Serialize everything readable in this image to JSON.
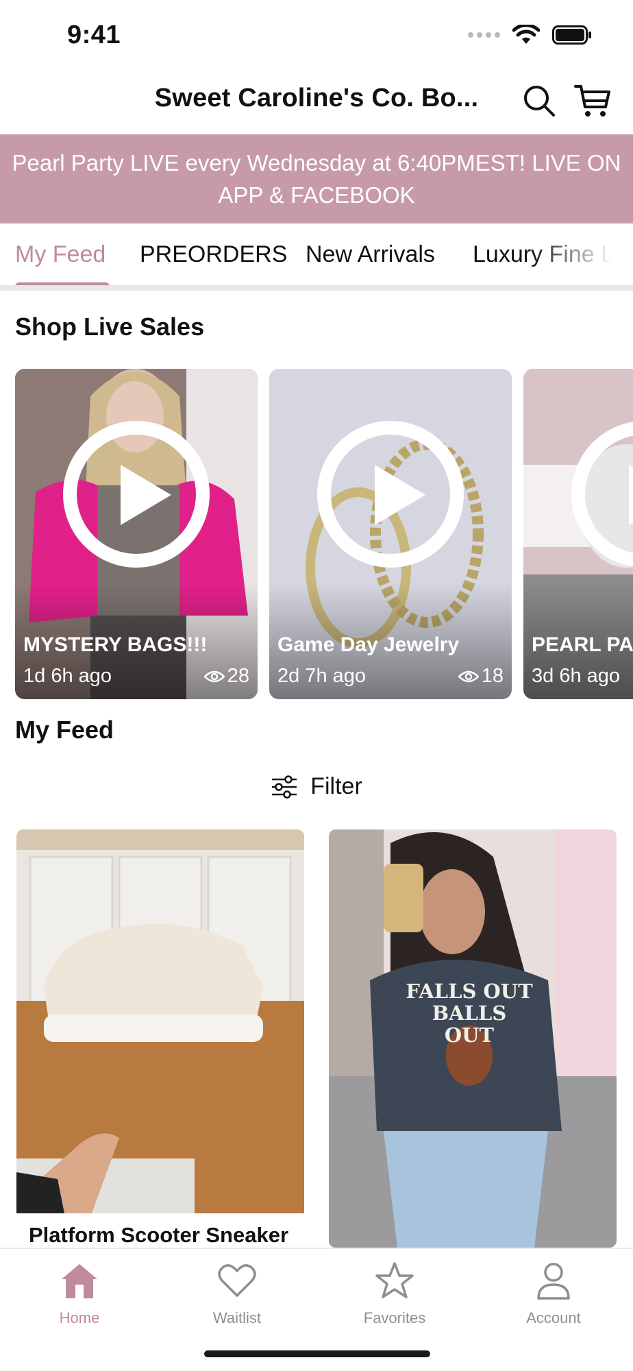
{
  "status_bar": {
    "time": "9:41"
  },
  "header": {
    "title": "Sweet Caroline's Co. Bo..."
  },
  "announcement": {
    "text": "Pearl Party LIVE every Wednesday at 6:40PMEST! LIVE ON APP & FACEBOOK"
  },
  "tabs": [
    {
      "label": "My Feed",
      "active": true
    },
    {
      "label": "PREORDERS"
    },
    {
      "label": "New Arrivals"
    },
    {
      "label": "Luxury Fine L"
    }
  ],
  "live_sales": {
    "title": "Shop Live Sales",
    "items": [
      {
        "title": "MYSTERY BAGS!!!",
        "time": "1d 6h ago",
        "views": "28"
      },
      {
        "title": "Game Day Jewelry",
        "time": "2d 7h ago",
        "views": "18"
      },
      {
        "title": "PEARL PAR",
        "time": "3d 6h ago",
        "views": ""
      }
    ]
  },
  "feed": {
    "title": "My Feed",
    "filter_label": "Filter",
    "items": [
      {
        "caption": "Platform Scooter Sneaker",
        "graphic_text": ""
      },
      {
        "caption": "",
        "graphic_text": "FALLS OUT BALLS OUT"
      }
    ]
  },
  "bottom_nav": [
    {
      "label": "Home",
      "icon": "home-icon",
      "active": true
    },
    {
      "label": "Waitlist",
      "icon": "heart-icon"
    },
    {
      "label": "Favorites",
      "icon": "star-icon"
    },
    {
      "label": "Account",
      "icon": "person-icon"
    }
  ],
  "colors": {
    "accent": "#c08a9a",
    "banner": "#c79aa8",
    "inactive": "#8e8e8e"
  }
}
